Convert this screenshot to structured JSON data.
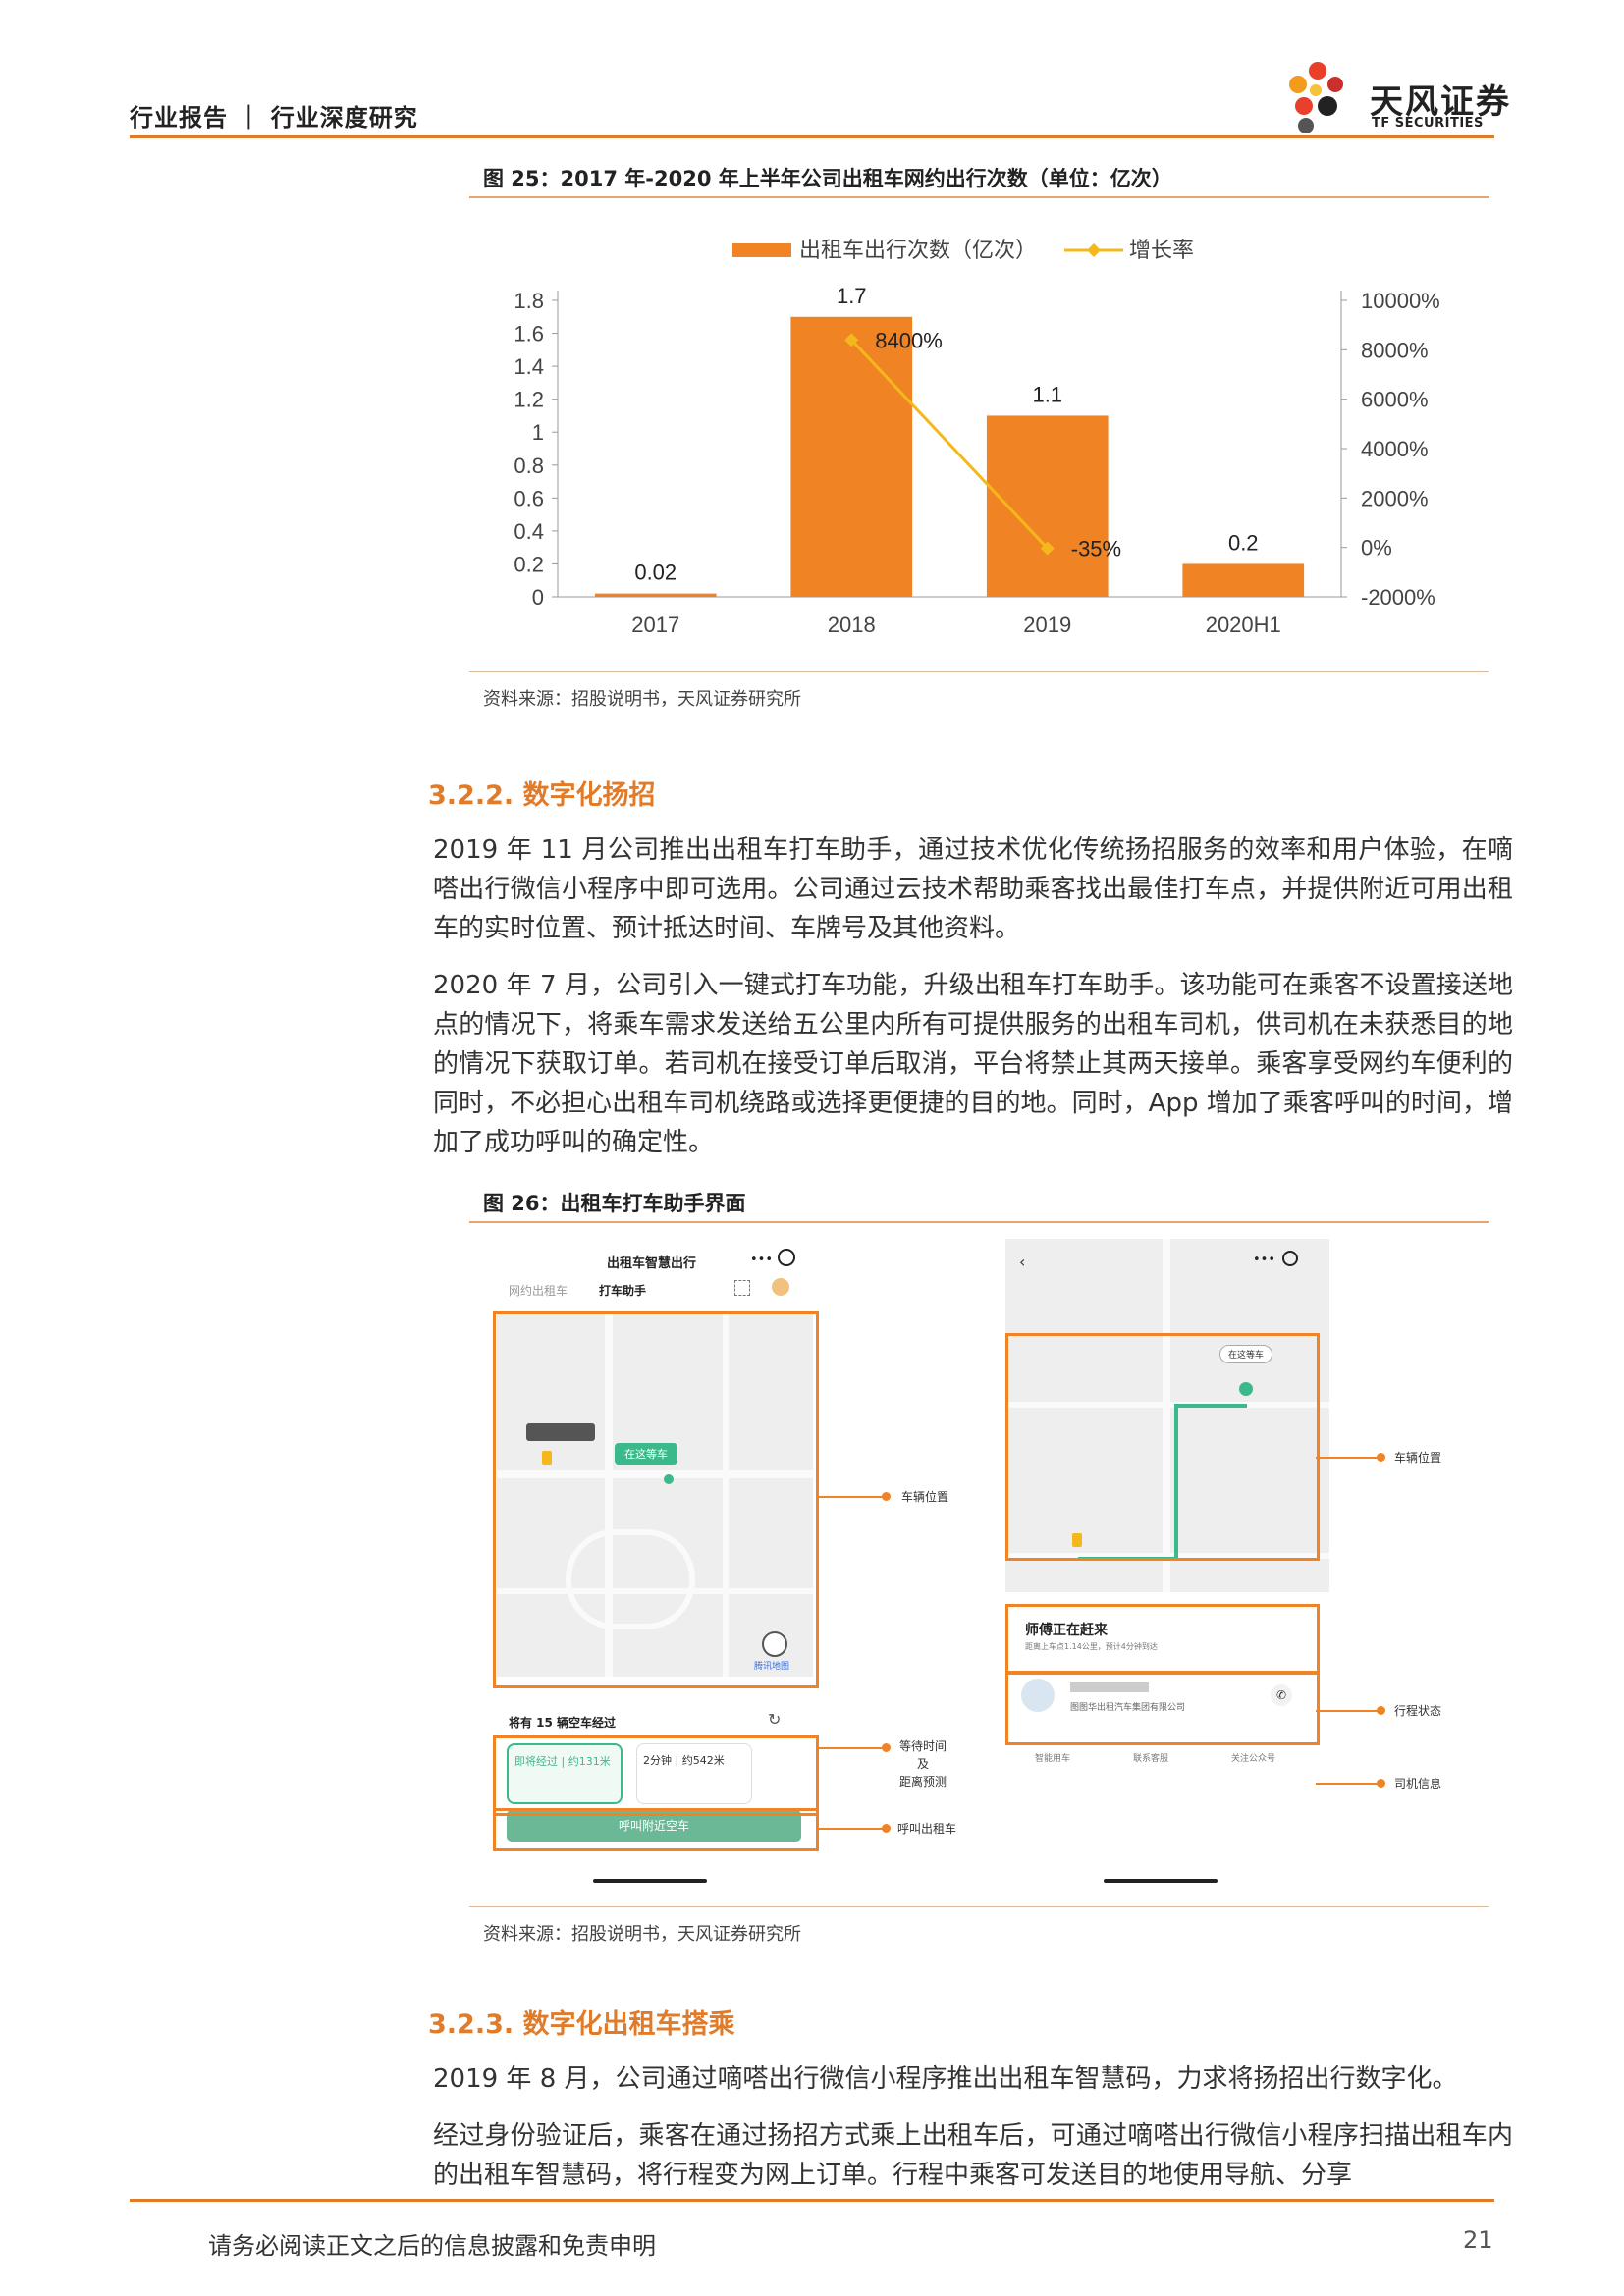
{
  "header": {
    "left": "行业报告 ｜ 行业深度研究",
    "logo_cn": "天风证券",
    "logo_en": "TF SECURITIES"
  },
  "figure25": {
    "title": "图 25：2017 年-2020 年上半年公司出租车网约出行次数（单位：亿次）",
    "source": "资料来源：招股说明书，天风证券研究所"
  },
  "chart_data": {
    "type": "bar",
    "categories": [
      "2017",
      "2018",
      "2019",
      "2020H1"
    ],
    "series": [
      {
        "name": "出租车出行次数（亿次）",
        "type": "bar",
        "axis": "left",
        "values": [
          0.02,
          1.7,
          1.1,
          0.2
        ],
        "labels": [
          "0.02",
          "1.7",
          "1.1",
          "0.2"
        ],
        "color": "#f08323"
      },
      {
        "name": "增长率",
        "type": "line",
        "axis": "right",
        "values": [
          null,
          8400,
          -35,
          null
        ],
        "labels": [
          "",
          "8400%",
          "-35%",
          ""
        ],
        "color": "#f5b81c"
      }
    ],
    "ylim_left": [
      0,
      1.8
    ],
    "yticks_left": [
      "0",
      "0.2",
      "0.4",
      "0.6",
      "0.8",
      "1",
      "1.2",
      "1.4",
      "1.6",
      "1.8"
    ],
    "ylim_right": [
      -2000,
      10000
    ],
    "yticks_right": [
      "-2000%",
      "0%",
      "2000%",
      "4000%",
      "6000%",
      "8000%",
      "10000%"
    ],
    "legend_position": "top",
    "grid": false
  },
  "section322": {
    "heading": "3.2.2. 数字化扬招",
    "p1": "2019 年 11 月公司推出出租车打车助手，通过技术优化传统扬招服务的效率和用户体验，在嘀嗒出行微信小程序中即可选用。公司通过云技术帮助乘客找出最佳打车点，并提供附近可用出租车的实时位置、预计抵达时间、车牌号及其他资料。",
    "p2": "2020 年 7 月，公司引入一键式打车功能，升级出租车打车助手。该功能可在乘客不设置接送地点的情况下，将乘车需求发送给五公里内所有可提供服务的出租车司机，供司机在未获悉目的地的情况下获取订单。若司机在接受订单后取消，平台将禁止其两天接单。乘客享受网约车便利的同时，不必担心出租车司机绕路或选择更便捷的目的地。同时，App 增加了乘客呼叫的时间，增加了成功呼叫的确定性。"
  },
  "figure26": {
    "title": "图 26：出租车打车助手界面",
    "source": "资料来源：招股说明书，天风证券研究所",
    "left_phone": {
      "title": "出租车智慧出行",
      "tab1": "网约出租车",
      "tab2": "打车助手",
      "pin": "在这等车",
      "map_brand": "腾讯地图",
      "empty_taxis": "将有 15 辆空车经过",
      "card1": "即将经过 | 约131米",
      "card2": "2分钟 | 约542米",
      "call_btn": "呼叫附近空车"
    },
    "right_phone": {
      "pin": "在这等车",
      "status": "师傅正在赶来",
      "status_sub": "距离上车点1.14公里，预计4分钟到达",
      "company": "图图华出租汽车集团有限公司",
      "nav1": "智能用车",
      "nav2": "联系客服",
      "nav3": "关注公众号"
    },
    "callouts": {
      "vehicle_pos_left": "车辆位置",
      "wait_time": "等待时间\n及\n距离预测",
      "call_taxi": "呼叫出租车",
      "vehicle_pos_right": "车辆位置",
      "trip_status": "行程状态",
      "driver_info": "司机信息"
    }
  },
  "section323": {
    "heading": "3.2.3. 数字化出租车搭乘",
    "p1": "2019 年 8 月，公司通过嘀嗒出行微信小程序推出出租车智慧码，力求将扬招出行数字化。",
    "p2": "经过身份验证后，乘客在通过扬招方式乘上出租车后，可通过嘀嗒出行微信小程序扫描出租车内的出租车智慧码，将行程变为网上订单。行程中乘客可发送目的地使用导航、分享"
  },
  "footer": {
    "disclaimer": "请务必阅读正文之后的信息披露和免责申明",
    "page": "21"
  }
}
